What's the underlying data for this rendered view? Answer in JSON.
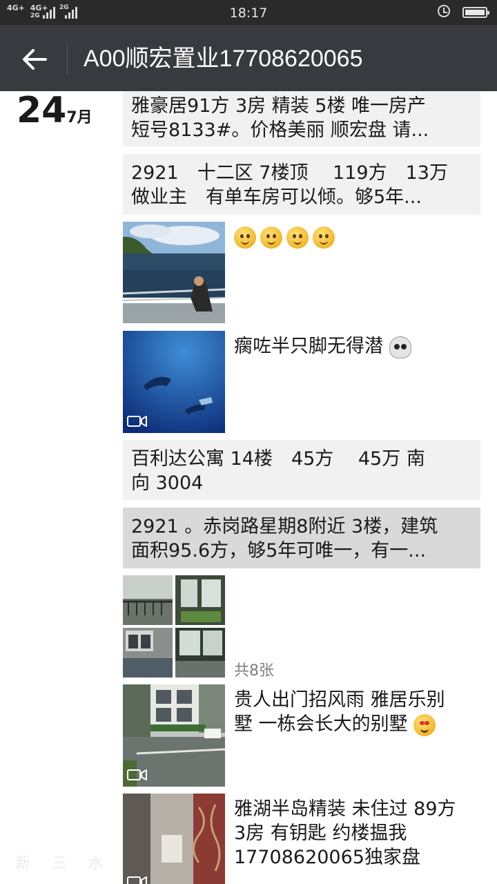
{
  "status_bar": {
    "network_1": "4G+",
    "network_2": "4G+",
    "network_3": "2G",
    "network_4": "2G",
    "time": "18:17"
  },
  "header": {
    "title": "A00顺宏置业17708620065"
  },
  "date": {
    "day": "24",
    "month": "7月"
  },
  "posts": [
    {
      "line1": "雅豪居91方 3房 精装 5楼 唯一房产",
      "line2": "短号8133#。价格美丽 顺宏盘 请..."
    },
    {
      "line1": "2921　十二区 7楼顶　 119方　13万",
      "line2": "做业主　有单车房可以倾。够5年..."
    },
    {
      "caption": ""
    },
    {
      "caption": "瘸咗半只脚无得潜"
    },
    {
      "line1": "百利达公寓  14楼　45方　 45万  南",
      "line2": "向  3004"
    },
    {
      "line1": "2921 。赤岗路星期8附近 3楼，建筑",
      "line2": "面积95.6方，够5年可唯一，有一..."
    },
    {
      "count": "共8张"
    },
    {
      "line1": "贵人出门招风雨 雅居乐别",
      "line2": "墅 一栋会长大的别墅"
    },
    {
      "line1": "雅湖半岛精装 未住过 89方",
      "line2": "3房 有钥匙 约楼揾我",
      "line3": "17708620065独家盘"
    }
  ],
  "watermark": "新 三 水",
  "icons": {
    "back": "arrow-left-icon",
    "video": "video-icon",
    "alarm": "alarm-clock-icon",
    "battery": "battery-icon"
  },
  "colors": {
    "title_bar": "#393a3f",
    "status_bar": "#2a2a2a",
    "post_bg": "#f1f1f1",
    "post_bg_selected": "#d9d9d9"
  }
}
